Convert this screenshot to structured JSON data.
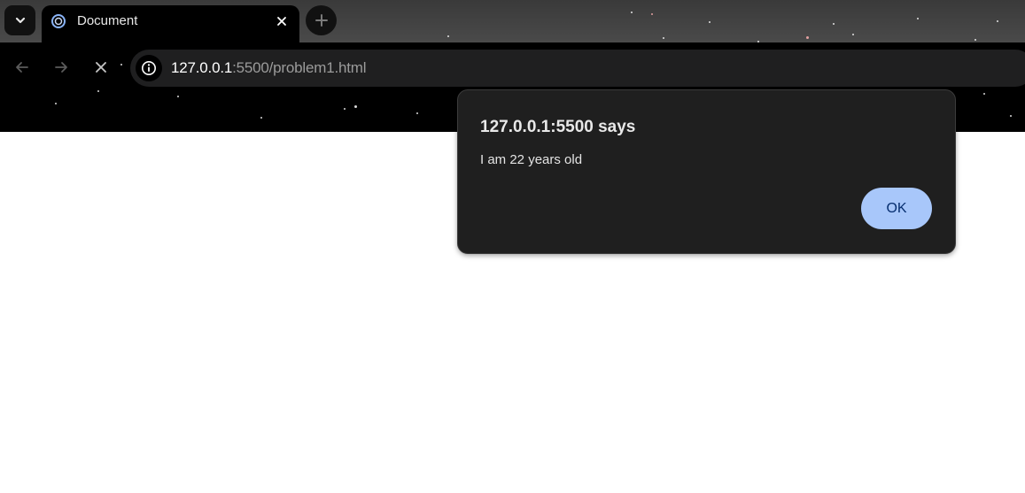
{
  "browser": {
    "tab": {
      "title": "Document",
      "close_glyph": "✕"
    },
    "new_tab_glyph": "+",
    "address": {
      "host": "127.0.0.1",
      "rest": ":5500/problem1.html"
    },
    "icons": {
      "tab_search": "chevron-down-icon",
      "favicon": "loading-spinner-icon",
      "back": "arrow-left-icon",
      "forward": "arrow-right-icon",
      "stop": "close-icon",
      "site_info": "info-icon"
    }
  },
  "dialog": {
    "title": "127.0.0.1:5500 says",
    "message": "I am 22 years old",
    "ok_label": "OK"
  },
  "colors": {
    "dialog_bg": "#1f1f1f",
    "ok_button": "#a8c7fa",
    "ok_text": "#062e6f"
  }
}
